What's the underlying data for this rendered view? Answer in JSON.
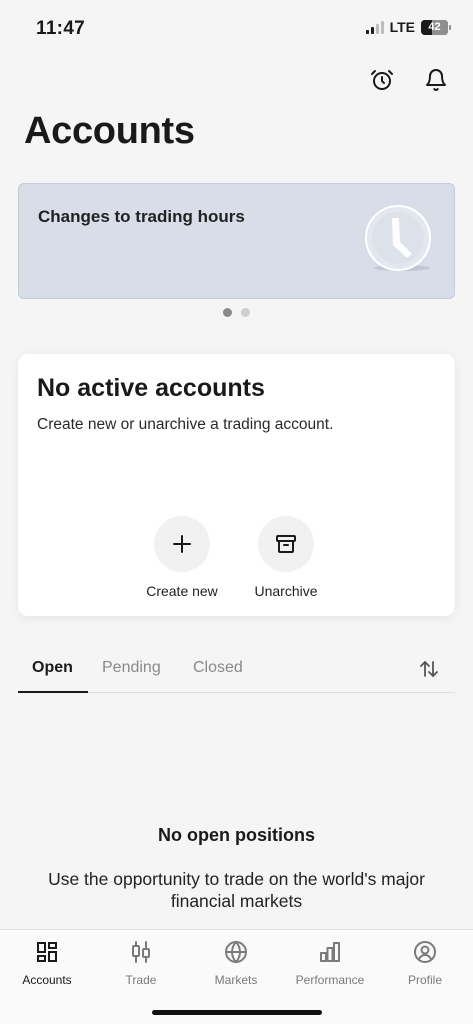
{
  "status_bar": {
    "time": "11:47",
    "network": "LTE",
    "battery": "42",
    "signal_bars_active": 2,
    "signal_bars_total": 4,
    "battery_level": 0.42
  },
  "header": {
    "title": "Accounts",
    "alarm_icon": "alarm-clock-icon",
    "bell_icon": "bell-icon"
  },
  "banner": {
    "title": "Changes to trading hours",
    "icon": "clock-illustration",
    "background": "#d9dde8",
    "page_count": 2,
    "active_page": 1
  },
  "accounts_card": {
    "title": "No active accounts",
    "subtitle": "Create new or unarchive a trading account.",
    "actions": [
      {
        "label": "Create new",
        "icon": "plus-icon"
      },
      {
        "label": "Unarchive",
        "icon": "archive-box-icon"
      }
    ]
  },
  "positions_tabs": {
    "tabs": [
      {
        "label": "Open",
        "active": true
      },
      {
        "label": "Pending",
        "active": false
      },
      {
        "label": "Closed",
        "active": false
      }
    ],
    "sort_icon": "sort-arrows-icon"
  },
  "empty_state": {
    "title": "No open positions",
    "message": "Use the opportunity to trade on the world's major financial markets"
  },
  "bottom_nav": {
    "items": [
      {
        "label": "Accounts",
        "icon": "grid-icon",
        "active": true
      },
      {
        "label": "Trade",
        "icon": "candlestick-icon",
        "active": false
      },
      {
        "label": "Markets",
        "icon": "globe-icon",
        "active": false
      },
      {
        "label": "Performance",
        "icon": "bar-chart-icon",
        "active": false
      },
      {
        "label": "Profile",
        "icon": "user-icon",
        "active": false
      }
    ]
  },
  "colors": {
    "background": "#f5f5f5",
    "text_primary": "#1a1a1a",
    "text_muted": "#8a8a8a",
    "card": "#ffffff"
  }
}
